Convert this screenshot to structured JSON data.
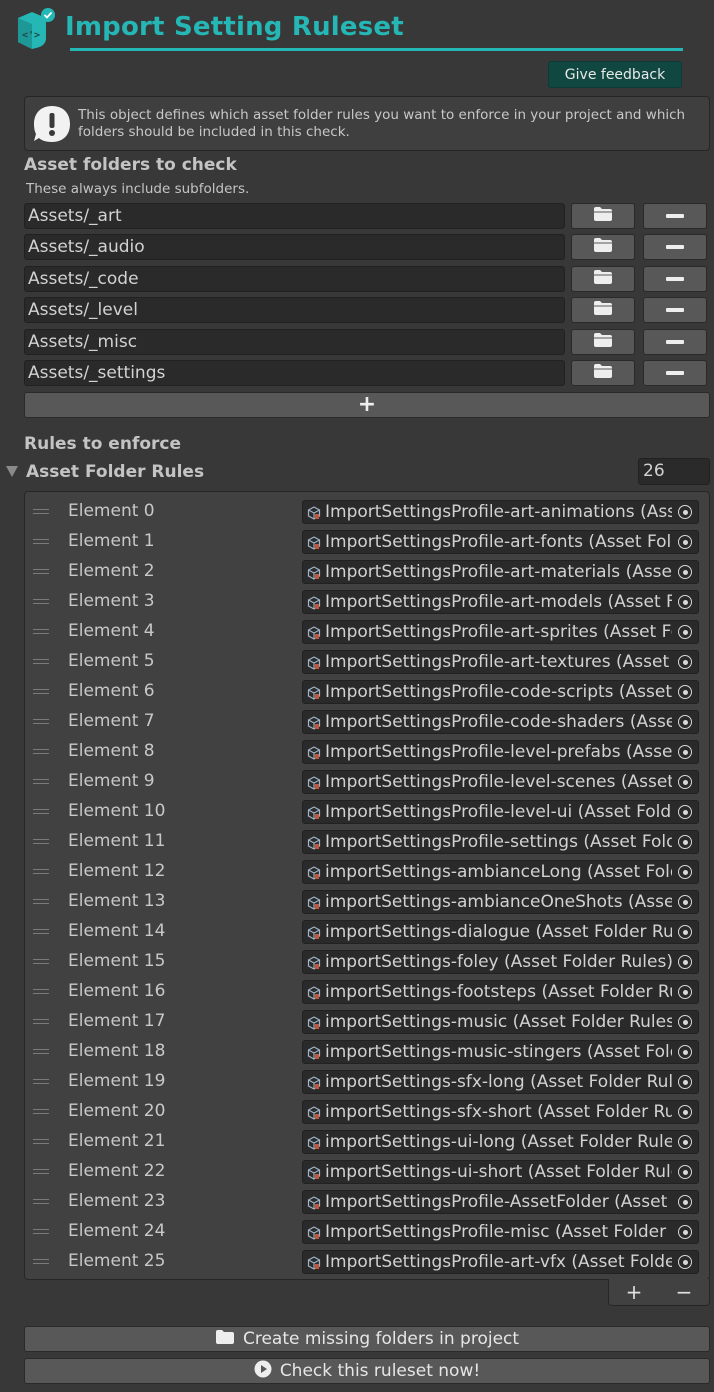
{
  "header": {
    "title": "Import Setting Ruleset",
    "logo_icon": "cube-mascot-icon",
    "accent_color": "#25b7b5",
    "feedback_label": "Give feedback"
  },
  "help": {
    "icon": "exclamation-icon",
    "text": "This object defines which asset folder rules you want to enforce in your project and which folders should be included in this check."
  },
  "folders": {
    "heading": "Asset folders to check",
    "subtitle": "These always include subfolders.",
    "items": [
      "Assets/_art",
      "Assets/_audio",
      "Assets/_code",
      "Assets/_level",
      "Assets/_misc",
      "Assets/_settings"
    ],
    "add_label": "+"
  },
  "rules": {
    "heading": "Rules to enforce",
    "list_title": "Asset Folder Rules",
    "count": "26",
    "elements": [
      {
        "label": "Element 0",
        "value": "ImportSettingsProfile-art-animations (Asset Folder Rules)"
      },
      {
        "label": "Element 1",
        "value": "ImportSettingsProfile-art-fonts (Asset Folder Rules)"
      },
      {
        "label": "Element 2",
        "value": "ImportSettingsProfile-art-materials (Asset Folder Rules)"
      },
      {
        "label": "Element 3",
        "value": "ImportSettingsProfile-art-models (Asset Folder Rules)"
      },
      {
        "label": "Element 4",
        "value": "ImportSettingsProfile-art-sprites (Asset Folder Rules)"
      },
      {
        "label": "Element 5",
        "value": "ImportSettingsProfile-art-textures (Asset Folder Rules)"
      },
      {
        "label": "Element 6",
        "value": "ImportSettingsProfile-code-scripts (Asset Folder Rules)"
      },
      {
        "label": "Element 7",
        "value": "ImportSettingsProfile-code-shaders (Asset Folder Rules)"
      },
      {
        "label": "Element 8",
        "value": "ImportSettingsProfile-level-prefabs (Asset Folder Rules)"
      },
      {
        "label": "Element 9",
        "value": "ImportSettingsProfile-level-scenes (Asset Folder Rules)"
      },
      {
        "label": "Element 10",
        "value": "ImportSettingsProfile-level-ui (Asset Folder Rules)"
      },
      {
        "label": "Element 11",
        "value": "ImportSettingsProfile-settings (Asset Folder Rules)"
      },
      {
        "label": "Element 12",
        "value": "importSettings-ambianceLong (Asset Folder Rules)"
      },
      {
        "label": "Element 13",
        "value": "importSettings-ambianceOneShots (Asset Folder Rules)"
      },
      {
        "label": "Element 14",
        "value": "importSettings-dialogue (Asset Folder Rules)"
      },
      {
        "label": "Element 15",
        "value": "importSettings-foley (Asset Folder Rules)"
      },
      {
        "label": "Element 16",
        "value": "importSettings-footsteps (Asset Folder Rules)"
      },
      {
        "label": "Element 17",
        "value": "importSettings-music (Asset Folder Rules)"
      },
      {
        "label": "Element 18",
        "value": "importSettings-music-stingers (Asset Folder Rules)"
      },
      {
        "label": "Element 19",
        "value": "importSettings-sfx-long (Asset Folder Rules)"
      },
      {
        "label": "Element 20",
        "value": "importSettings-sfx-short (Asset Folder Rules)"
      },
      {
        "label": "Element 21",
        "value": "importSettings-ui-long (Asset Folder Rules)"
      },
      {
        "label": "Element 22",
        "value": "importSettings-ui-short (Asset Folder Rules)"
      },
      {
        "label": "Element 23",
        "value": "ImportSettingsProfile-AssetFolder (Asset Folder Rules)"
      },
      {
        "label": "Element 24",
        "value": "ImportSettingsProfile-misc (Asset Folder Rules)"
      },
      {
        "label": "Element 25",
        "value": "ImportSettingsProfile-art-vfx (Asset Folder Rules)"
      }
    ],
    "add_label": "+",
    "remove_label": "−"
  },
  "actions": {
    "create_label": "Create missing folders in project",
    "check_label": "Check this ruleset now!"
  }
}
